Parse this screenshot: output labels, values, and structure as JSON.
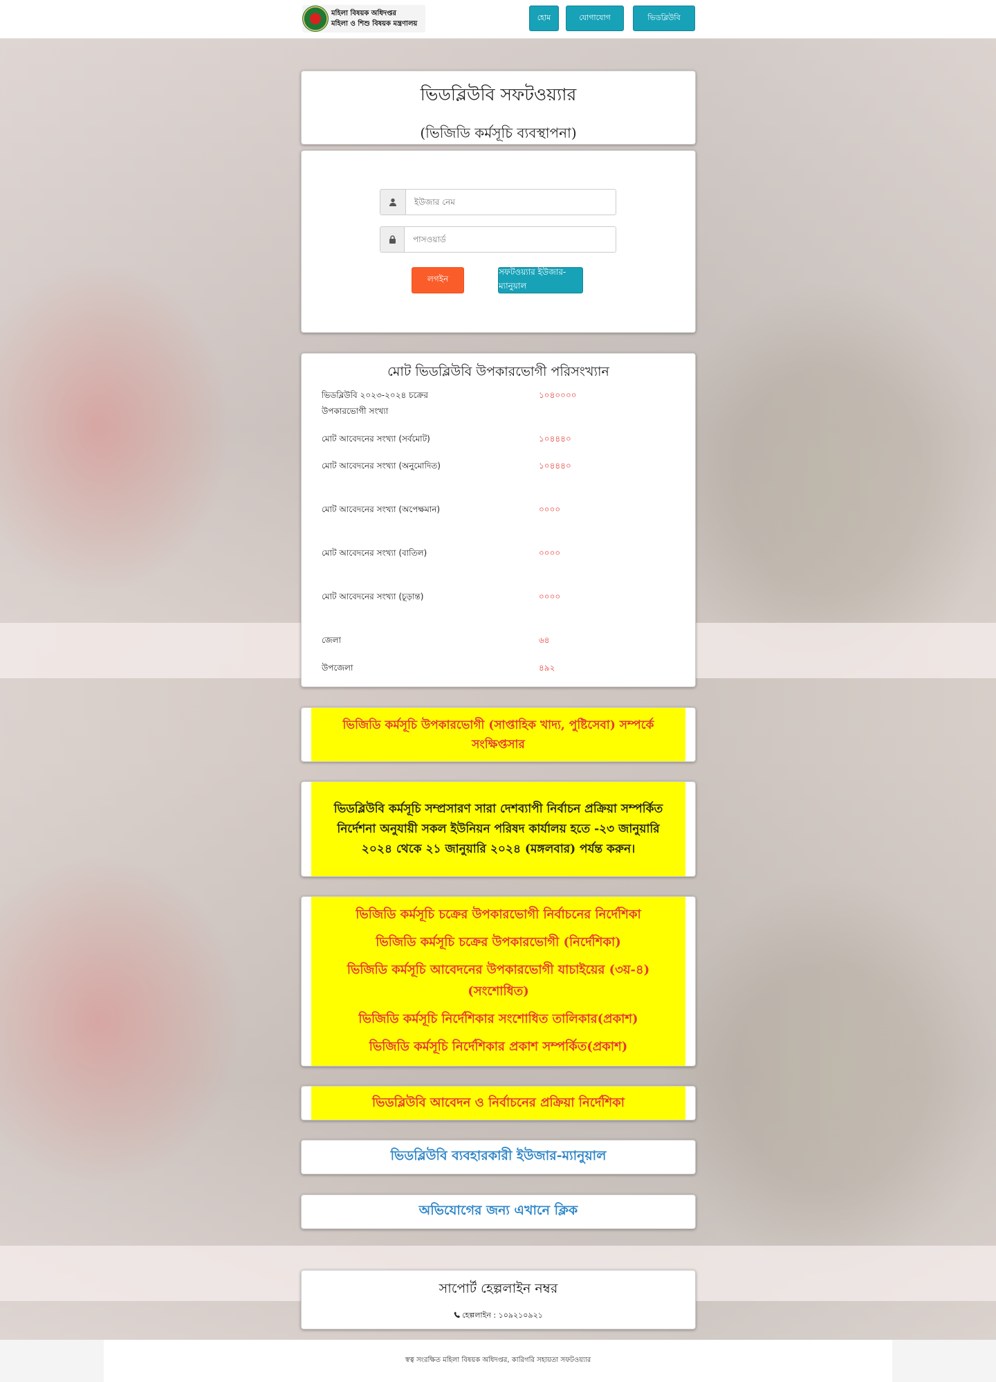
{
  "header": {
    "logo_line1": "মহিলা বিষয়ক অধিদপ্তর",
    "logo_line2": "মহিলা ও শিশু বিষয়ক মন্ত্রণালয়",
    "nav": [
      "হোম",
      "যোগাযোগ",
      "ভিডব্লিউবি"
    ]
  },
  "title": {
    "main": "ভিডব্লিউবি সফটওয়্যার",
    "sub": "(ভিজিডি কর্মসূচি ব্যবস্থাপনা)"
  },
  "login": {
    "username_placeholder": "ইউজার নেম",
    "password_placeholder": "পাসওয়ার্ড",
    "login_button": "লগইন",
    "guide_button": "সফটওয়্যার ইউজার-ম্যানুয়াল"
  },
  "stats": {
    "title": "মোট ভিডব্লিউবি উপকারভোগী পরিসংখ্যান",
    "rows": [
      {
        "label": "ভিডব্লিউবি ২০২৩-২০২৪ চক্রের উপকারভোগী সংখ্যা",
        "value": "১০৪০০০০"
      },
      {
        "label": "মোট আবেদনের সংখ্যা (সর্বমোট)",
        "value": "১০৪৪৪০"
      },
      {
        "label": "মোট আবেদনের সংখ্যা (অনুমোদিত)",
        "value": "১০৪৪৪০"
      },
      {
        "label": "মোট আবেদনের সংখ্যা (অপেক্ষমান)",
        "value": "০০০০"
      },
      {
        "label": "মোট আবেদনের সংখ্যা (বাতিল)",
        "value": "০০০০"
      },
      {
        "label": "মোট আবেদনের সংখ্যা (চূড়ান্ত)",
        "value": "০০০০"
      },
      {
        "label": "জেলা",
        "value": "৬৪"
      },
      {
        "label": "উপজেলা",
        "value": "৪৯২"
      }
    ]
  },
  "notices": {
    "n1": "ভিজিডি কর্মসূচি উপকারভোগী (সাপ্তাহিক খাদ্য, পুষ্টিসেবা) সম্পর্কে সংক্ষিপ্তসার",
    "n2": "ভিডব্লিউবি কর্মসূচি সম্প্রসারণ সারা দেশব্যাপী নির্বাচন প্রক্রিয়া সম্পর্কিত নির্দেশনা অনুযায়ী সকল ইউনিয়ন পরিষদ কার্যালয় হতে -২৩ জানুয়ারি ২০২৪ থেকে ২১ জানুয়ারি ২০২৪ (মঙ্গলবার) পর্যন্ত করুন।",
    "n3": [
      "ভিজিডি কর্মসূচি চক্রের উপকারভোগী নির্বাচনের নির্দেশিকা",
      "ভিজিডি কর্মসূচি চক্রের উপকারভোগী (নির্দেশিকা)",
      "ভিজিডি কর্মসূচি আবেদনের উপকারভোগী যাচাইয়ের (৩য়-৪) (সংশোধিত)",
      "ভিজিডি কর্মসূচি নির্দেশিকার সংশোধিত তালিকার(প্রকাশ)",
      "ভিজিডি কর্মসূচি নির্দেশিকার প্রকাশ সম্পর্কিত(প্রকাশ)"
    ],
    "n4": "ভিডব্লিউবি আবেদন ও নির্বাচনের প্রক্রিয়া নির্দেশিকা"
  },
  "links": {
    "manual": "ভিডব্লিউবি ব্যবহারকারী ইউজার-ম্যানুয়াল",
    "complaint": "অভিযোগের জন্য এখানে ক্লিক"
  },
  "helpdesk": {
    "title": "সাপোর্ট হেল্পলাইন নম্বর",
    "phone": "হেল্পলাইন : ১০৯২১০৯২১"
  },
  "footer": {
    "text": "স্বত্ব সংরক্ষিত মহিলা বিষয়ক অধিদপ্তর, কারিগরি সহায়তা সফটওয়্যার"
  },
  "colors": {
    "accent": "#17a2b8",
    "login": "#fb5d2a",
    "notice_bg": "#ffff00",
    "notice_text": "#e53935",
    "link": "#2f86c8"
  }
}
